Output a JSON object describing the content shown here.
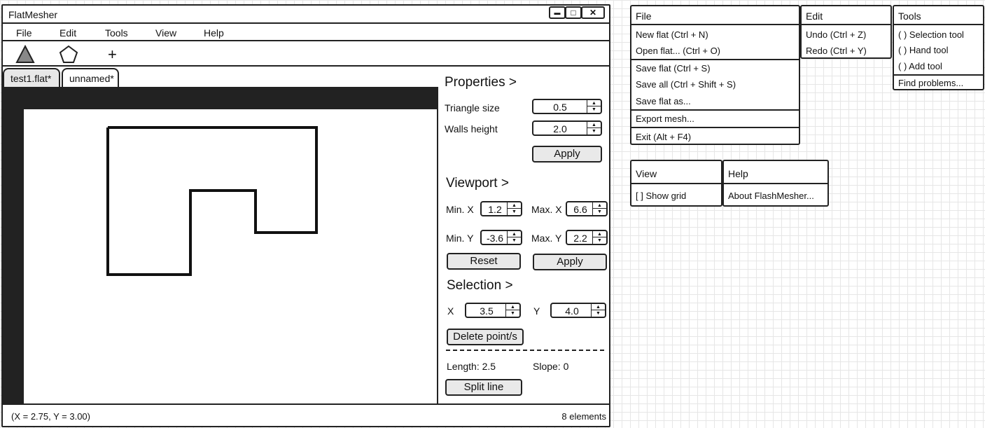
{
  "window": {
    "title": "FlatMesher",
    "controls": {
      "minimize": "▬",
      "maximize": "□",
      "close": "✕"
    }
  },
  "menubar": [
    "File",
    "Edit",
    "Tools",
    "View",
    "Help"
  ],
  "toolbar": {
    "triangle_icon": "triangle-tool",
    "polygon_icon": "polygon-tool",
    "add_label": "+"
  },
  "tabs": [
    "test1.flat*",
    "unnamed*"
  ],
  "properties": {
    "heading": "Properties >",
    "triangle_size_label": "Triangle size",
    "triangle_size": "0.5",
    "walls_height_label": "Walls height",
    "walls_height": "2.0",
    "apply": "Apply"
  },
  "viewport": {
    "heading": "Viewport >",
    "min_x_label": "Min. X",
    "min_x": "1.2",
    "max_x_label": "Max. X",
    "max_x": "6.6",
    "min_y_label": "Min. Y",
    "min_y": "-3.6",
    "max_y_label": "Max. Y",
    "max_y": "2.2",
    "reset": "Reset",
    "apply": "Apply"
  },
  "selection": {
    "heading": "Selection >",
    "x_label": "X",
    "x": "3.5",
    "y_label": "Y",
    "y": "4.0",
    "delete": "Delete point/s",
    "length": "Length: 2.5",
    "slope": "Slope: 0",
    "split": "Split line"
  },
  "status": {
    "coords": "(X = 2.75, Y = 3.00)",
    "elements": "8 elements"
  },
  "menus": {
    "file": {
      "title": "File",
      "items": [
        "New flat (Ctrl + N)",
        "Open flat... (Ctrl + O)",
        "Save flat (Ctrl + S)",
        "Save all (Ctrl + Shift + S)",
        "Save flat as...",
        "Export mesh...",
        "Exit (Alt + F4)"
      ]
    },
    "edit": {
      "title": "Edit",
      "items": [
        "Undo (Ctrl + Z)",
        "Redo (Ctrl + Y)"
      ]
    },
    "tools": {
      "title": "Tools",
      "items": [
        "( ) Selection tool",
        "( ) Hand tool",
        "( ) Add tool",
        "Find problems..."
      ]
    },
    "view": {
      "title": "View",
      "items": [
        "[ ] Show grid"
      ]
    },
    "help": {
      "title": "Help",
      "items": [
        "About FlashMesher..."
      ]
    }
  },
  "colors": {
    "stroke": "#222222",
    "triangle_fill": "#888888",
    "background_grid": "#e6e6e6"
  }
}
